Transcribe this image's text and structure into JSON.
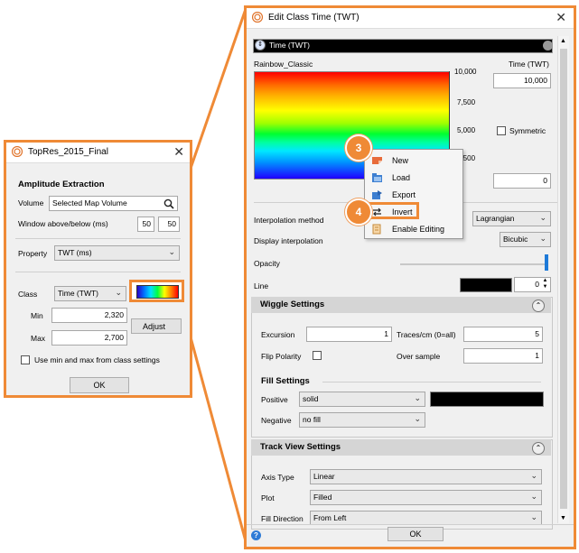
{
  "left_dialog": {
    "title": "TopRes_2015_Final",
    "section_title": "Amplitude Extraction",
    "volume_label": "Volume",
    "volume_value": "Selected Map Volume",
    "window_label": "Window above/below (ms)",
    "window_above": "50",
    "window_below": "50",
    "property_label": "Property",
    "property_value": "TWT (ms)",
    "class_label": "Class",
    "class_value": "Time (TWT)",
    "min_label": "Min",
    "min_value": "2,320",
    "max_label": "Max",
    "max_value": "2,700",
    "adjust_label": "Adjust",
    "use_minmax_label": "Use min and max from class settings",
    "ok_label": "OK"
  },
  "right_dialog": {
    "title": "Edit Class Time (TWT)",
    "class_name": "Time (TWT)",
    "colormap_name": "Rainbow_Classic",
    "axis_title": "Time (TWT)",
    "max_value": "10,000",
    "min_value": "0",
    "ticks": [
      "10,000",
      "7,500",
      "5,000",
      "2,500"
    ],
    "symmetric_label": "Symmetric",
    "interpolation_label": "Interpolation method",
    "interpolation_value": "Lagrangian",
    "display_interp_label": "Display interpolation",
    "display_interp_value": "Bicubic",
    "opacity_label": "Opacity",
    "line_label": "Line",
    "line_width": "0",
    "wiggle": {
      "title": "Wiggle Settings",
      "excursion_label": "Excursion",
      "excursion_value": "1",
      "traces_label": "Traces/cm (0=all)",
      "traces_value": "5",
      "flip_label": "Flip Polarity",
      "oversample_label": "Over sample",
      "oversample_value": "1"
    },
    "fill": {
      "title": "Fill Settings",
      "positive_label": "Positive",
      "positive_value": "solid",
      "negative_label": "Negative",
      "negative_value": "no fill"
    },
    "track": {
      "title": "Track View Settings",
      "axis_type_label": "Axis Type",
      "axis_type_value": "Linear",
      "plot_label": "Plot",
      "plot_value": "Filled",
      "fill_dir_label": "Fill Direction",
      "fill_dir_value": "From Left"
    },
    "ok_label": "OK"
  },
  "context_menu": {
    "items": [
      "New",
      "Load",
      "Export",
      "Invert",
      "Enable Editing"
    ]
  },
  "callouts": {
    "step3": "3",
    "step4": "4"
  },
  "colors": {
    "accent": "#ef8a36",
    "highlight_box": "#ef8a36"
  }
}
